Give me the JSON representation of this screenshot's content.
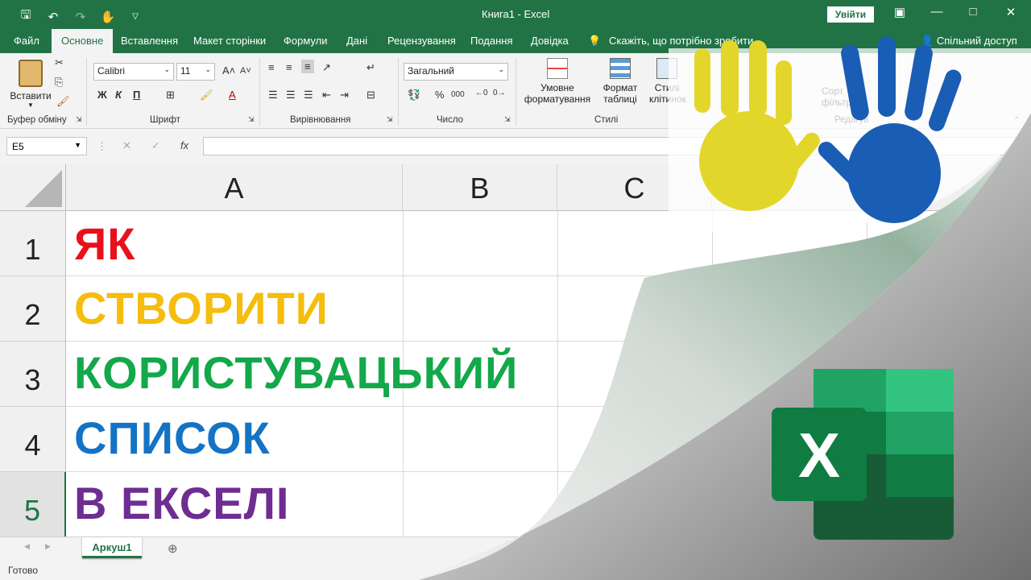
{
  "window": {
    "title": "Книга1  -  Excel",
    "signin": "Увійти"
  },
  "tabs": [
    {
      "label": "Файл"
    },
    {
      "label": "Основне"
    },
    {
      "label": "Вставлення"
    },
    {
      "label": "Макет сторінки"
    },
    {
      "label": "Формули"
    },
    {
      "label": "Дані"
    },
    {
      "label": "Рецензування"
    },
    {
      "label": "Подання"
    },
    {
      "label": "Довідка"
    }
  ],
  "tellme": "Скажіть, що потрібно зробити",
  "share": "Спільний доступ",
  "ribbon": {
    "paste": "Вставити",
    "font_name": "Calibri",
    "font_size": "11",
    "bold": "Ж",
    "italic": "К",
    "underline": "П",
    "number_format": "Загальний",
    "percent": "%",
    "thousands": "000",
    "cond_format_1": "Умовне",
    "cond_format_2": "форматування",
    "table_format_1": "Формат",
    "table_format_2": "таблиці",
    "cell_styles_1": "Стилі",
    "cell_styles_2": "клітинок",
    "sort_1": "Сорт",
    "sort_2": "фільтр",
    "groups": {
      "clipboard": "Буфер обміну",
      "font": "Шрифт",
      "alignment": "Вирівнювання",
      "number": "Число",
      "styles": "Стилі",
      "editing": "Редагув"
    }
  },
  "formula_bar": {
    "name_box": "E5",
    "fx": "fx",
    "value": ""
  },
  "columns": [
    "A",
    "B",
    "C"
  ],
  "rows": [
    "1",
    "2",
    "3",
    "4",
    "5"
  ],
  "cells": [
    {
      "ref": "A1",
      "text": "ЯК",
      "color": "#e8111b"
    },
    {
      "ref": "A2",
      "text": "СТВОРИТИ",
      "color": "#f5bd0c"
    },
    {
      "ref": "A3",
      "text": "КОРИСТУВАЦЬКИЙ",
      "color": "#13a84a"
    },
    {
      "ref": "A4",
      "text": "СПИСОК",
      "color": "#1473c4"
    },
    {
      "ref": "A5",
      "text": "В ЕКСЕЛІ",
      "color": "#6f2c91"
    }
  ],
  "sheet_tab": "Аркуш1",
  "status": "Готово",
  "colors": {
    "excel_green": "#217346",
    "hand_yellow": "#e3d62a",
    "hand_blue": "#1a5db5"
  }
}
